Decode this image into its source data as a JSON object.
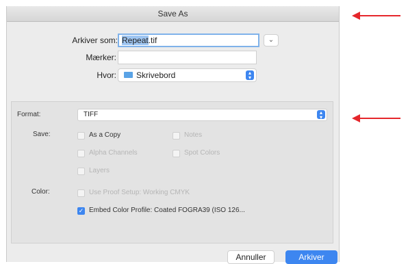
{
  "dialog": {
    "title": "Save As",
    "name_label": "Arkiver som:",
    "name_selected": "Repeat",
    "name_extension": ".tif",
    "tags_label": "Mærker:",
    "tags_value": "",
    "where_label": "Hvor:",
    "where_value": "Skrivebord",
    "expand_icon": "chevron-down-icon"
  },
  "options": {
    "format_label": "Format:",
    "format_value": "TIFF",
    "save_label": "Save:",
    "color_label": "Color:",
    "checkboxes": [
      {
        "label": "As a Copy",
        "checked": false,
        "enabled": true
      },
      {
        "label": "Notes",
        "checked": false,
        "enabled": false
      },
      {
        "label": "Alpha Channels",
        "checked": false,
        "enabled": false
      },
      {
        "label": "Spot Colors",
        "checked": false,
        "enabled": false
      },
      {
        "label": "Layers",
        "checked": false,
        "enabled": false
      },
      {
        "label": "Use Proof Setup:  Working CMYK",
        "checked": false,
        "enabled": false
      },
      {
        "label": "Embed Color Profile:  Coated FOGRA39 (ISO 126...",
        "checked": true,
        "enabled": true
      }
    ]
  },
  "buttons": {
    "cancel": "Annuller",
    "save": "Arkiver"
  },
  "annotations": {
    "arrow_color": "#e5262b",
    "accent": "#3d86f0"
  }
}
